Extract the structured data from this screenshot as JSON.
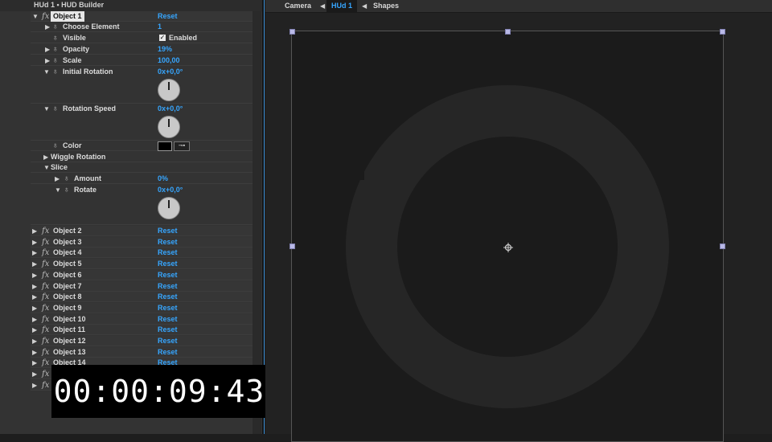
{
  "left_panel": {
    "title": "HUd 1 • HUD Builder",
    "object1": {
      "label": "Object 1",
      "reset": "Reset",
      "params": {
        "choose_element": {
          "label": "Choose Element",
          "value": "1"
        },
        "visible": {
          "label": "Visible",
          "check": "✓",
          "value": "Enabled"
        },
        "opacity": {
          "label": "Opacity",
          "value": "19%"
        },
        "scale": {
          "label": "Scale",
          "value": "100,00"
        },
        "initial_rotation": {
          "label": "Initial Rotation",
          "value": "0x+0,0°"
        },
        "rotation_speed": {
          "label": "Rotation Speed",
          "value": "0x+0,0°"
        },
        "color": {
          "label": "Color",
          "swatch_color": "#000000",
          "eyedropper": "⊸▪"
        },
        "wiggle_rotation": {
          "label": "Wiggle Rotation"
        },
        "slice": {
          "label": "Slice"
        },
        "amount": {
          "label": "Amount",
          "value": "0%"
        },
        "rotate": {
          "label": "Rotate",
          "value": "0x+0,0°"
        }
      }
    },
    "objects": [
      {
        "label": "Object 2",
        "reset": "Reset"
      },
      {
        "label": "Object 3",
        "reset": "Reset"
      },
      {
        "label": "Object 4",
        "reset": "Reset"
      },
      {
        "label": "Object 5",
        "reset": "Reset"
      },
      {
        "label": "Object 6",
        "reset": "Reset"
      },
      {
        "label": "Object 7",
        "reset": "Reset"
      },
      {
        "label": "Object 8",
        "reset": "Reset"
      },
      {
        "label": "Object 9",
        "reset": "Reset"
      },
      {
        "label": "Object 10",
        "reset": "Reset"
      },
      {
        "label": "Object 11",
        "reset": "Reset"
      },
      {
        "label": "Object 12",
        "reset": "Reset"
      },
      {
        "label": "Object 13",
        "reset": "Reset"
      },
      {
        "label": "Object 14",
        "reset": "Reset"
      }
    ],
    "fx_symbol": "fx",
    "stopwatch_symbol": "♁",
    "triangle_open": "▼",
    "triangle_closed": "▶"
  },
  "timecode": "00:00:09:43",
  "viewer": {
    "tabs": [
      {
        "label": "Camera"
      },
      {
        "label": "HUd 1"
      },
      {
        "label": "Shapes"
      }
    ],
    "tab_arrow": "◀"
  },
  "colors": {
    "accent": "#36a6ff",
    "panel": "#333333",
    "canvas": "#1b1b1b",
    "hud_shape": "#262626"
  }
}
